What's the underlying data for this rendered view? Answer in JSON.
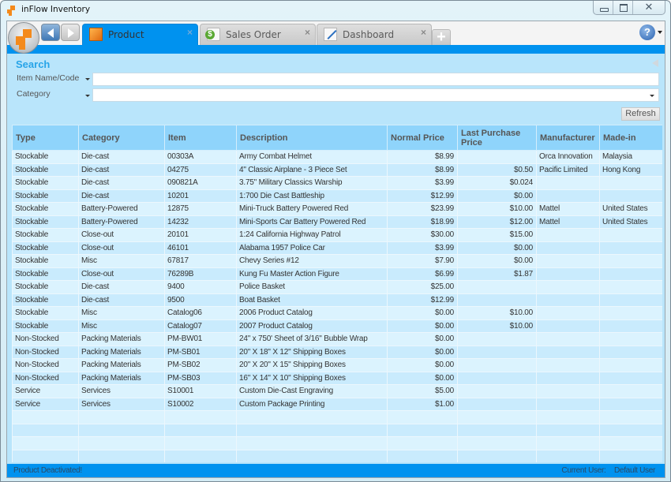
{
  "window": {
    "title": "inFlow Inventory",
    "controls": {
      "minimize_icon": "minimize-icon",
      "maximize_icon": "maximize-icon",
      "close_glyph": "✕"
    }
  },
  "nav": {
    "back_icon": "arrow-left-icon",
    "forward_icon": "arrow-right-icon"
  },
  "tabs": [
    {
      "label": "Product",
      "icon": "product-icon",
      "active": true,
      "close": "×"
    },
    {
      "label": "Sales Order",
      "icon": "sales-order-icon",
      "active": false,
      "close": "×"
    },
    {
      "label": "Dashboard",
      "icon": "dashboard-icon",
      "active": false,
      "close": "×"
    }
  ],
  "add_tab_glyph": "+",
  "help_glyph": "?",
  "search": {
    "title": "Search",
    "item_label": "Item Name/Code",
    "item_value": "",
    "category_label": "Category",
    "category_value": "",
    "refresh_label": "Refresh"
  },
  "table": {
    "columns": [
      "Type",
      "Category",
      "Item",
      "Description",
      "Normal Price",
      "Last Purchase Price",
      "Manufacturer",
      "Made-in"
    ],
    "rows": [
      [
        "Stockable",
        "Die-cast",
        "00303A",
        "Army Combat Helmet",
        "$8.99",
        "",
        "Orca Innovation",
        "Malaysia"
      ],
      [
        "Stockable",
        "Die-cast",
        "04275",
        "4\" Classic Airplane - 3 Piece Set",
        "$8.99",
        "$0.50",
        "Pacific Limited",
        "Hong Kong"
      ],
      [
        "Stockable",
        "Die-cast",
        "090821A",
        "3.75\" Military Classics Warship",
        "$3.99",
        "$0.024",
        "",
        ""
      ],
      [
        "Stockable",
        "Die-cast",
        "10201",
        "1:700 Die Cast Battleship",
        "$12.99",
        "$0.00",
        "",
        ""
      ],
      [
        "Stockable",
        "Battery-Powered",
        "12875",
        "Mini-Truck Battery Powered Red",
        "$23.99",
        "$10.00",
        "Mattel",
        "United States"
      ],
      [
        "Stockable",
        "Battery-Powered",
        "14232",
        "Mini-Sports Car Battery Powered Red",
        "$18.99",
        "$12.00",
        "Mattel",
        "United States"
      ],
      [
        "Stockable",
        "Close-out",
        "20101",
        "1:24 California Highway Patrol",
        "$30.00",
        "$15.00",
        "",
        ""
      ],
      [
        "Stockable",
        "Close-out",
        "46101",
        "Alabama 1957 Police Car",
        "$3.99",
        "$0.00",
        "",
        ""
      ],
      [
        "Stockable",
        "Misc",
        "67817",
        "Chevy Series #12",
        "$7.90",
        "$0.00",
        "",
        ""
      ],
      [
        "Stockable",
        "Close-out",
        "76289B",
        "Kung Fu Master Action Figure",
        "$6.99",
        "$1.87",
        "",
        ""
      ],
      [
        "Stockable",
        "Die-cast",
        "9400",
        "Police Basket",
        "$25.00",
        "",
        "",
        ""
      ],
      [
        "Stockable",
        "Die-cast",
        "9500",
        "Boat Basket",
        "$12.99",
        "",
        "",
        ""
      ],
      [
        "Stockable",
        "Misc",
        "Catalog06",
        "2006 Product Catalog",
        "$0.00",
        "$10.00",
        "",
        ""
      ],
      [
        "Stockable",
        "Misc",
        "Catalog07",
        "2007 Product Catalog",
        "$0.00",
        "$10.00",
        "",
        ""
      ],
      [
        "Non-Stocked",
        "Packing Materials",
        "PM-BW01",
        "24\" x 750' Sheet of 3/16\" Bubble Wrap",
        "$0.00",
        "",
        "",
        ""
      ],
      [
        "Non-Stocked",
        "Packing Materials",
        "PM-SB01",
        "20\" X 18\" X 12\" Shipping Boxes",
        "$0.00",
        "",
        "",
        ""
      ],
      [
        "Non-Stocked",
        "Packing Materials",
        "PM-SB02",
        "20\" X 20\" X 15\" Shipping Boxes",
        "$0.00",
        "",
        "",
        ""
      ],
      [
        "Non-Stocked",
        "Packing Materials",
        "PM-SB03",
        "16\" X 14\" X 10\" Shipping Boxes",
        "$0.00",
        "",
        "",
        ""
      ],
      [
        "Service",
        "Services",
        "S10001",
        "Custom Die-Cast Engraving",
        "$5.00",
        "",
        "",
        ""
      ],
      [
        "Service",
        "Services",
        "S10002",
        "Custom Package Printing",
        "$1.00",
        "",
        "",
        ""
      ]
    ],
    "empty_rows": 4
  },
  "status": {
    "message": "Product Deactivated!",
    "user_label": "Current User:",
    "user_value": "Default User"
  }
}
